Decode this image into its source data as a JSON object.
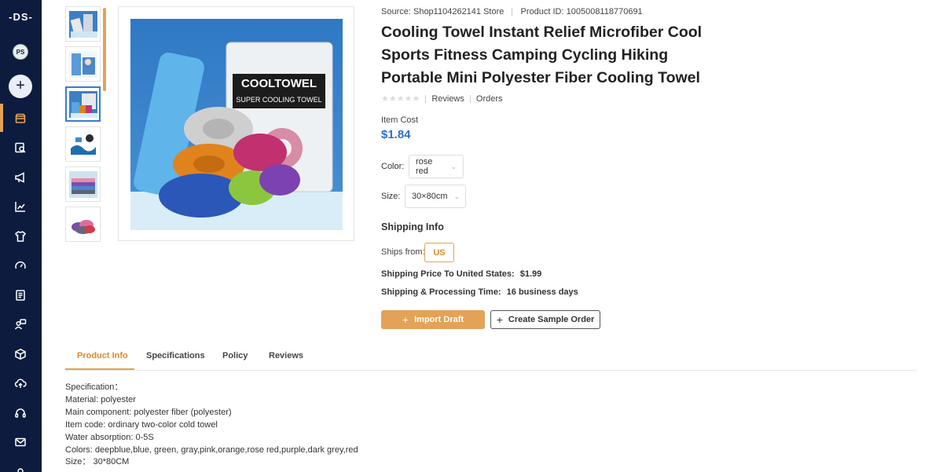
{
  "sidebar": {
    "logo": "-DS-",
    "avatar_initials": "PS",
    "add_label": "+",
    "nav_icons": [
      "store-icon",
      "product-search-icon",
      "megaphone-icon",
      "analytics-icon",
      "apparel-icon",
      "dashboard-gauge-icon",
      "orders-list-icon",
      "support-agent-icon",
      "package-icon",
      "cloud-upload-icon",
      "headset-icon",
      "mail-icon"
    ]
  },
  "product": {
    "source_prefix": "Source:",
    "source_store": "Shop1104262141 Store",
    "product_id_prefix": "Product ID:",
    "product_id": "1005008118770691",
    "title": "Cooling Towel Instant Relief Microfiber Cool Sports Fitness Camping Cycling Hiking Portable Mini Polyester Fiber Cooling Towel",
    "stars": "★★★★★",
    "reviews_label": "Reviews",
    "orders_label": "Orders",
    "item_cost_label": "Item Cost",
    "item_cost": "$1.84",
    "color_label": "Color:",
    "color_value": "rose red",
    "size_label": "Size:",
    "size_value": "30×80cm",
    "image_brand_text": "COOLTOWEL",
    "image_sub_text": "SUPER COOLING TOWEL"
  },
  "shipping": {
    "heading": "Shipping Info",
    "ships_from_label": "Ships from:",
    "ships_from_value": "US",
    "price_label": "Shipping Price To United States:",
    "price_value": "$1.99",
    "time_label": "Shipping & Processing Time:",
    "time_value": "16 business days"
  },
  "actions": {
    "import_label": "Import Draft",
    "sample_label": "Create Sample Order"
  },
  "tabs": [
    {
      "label": "Product Info"
    },
    {
      "label": "Specifications"
    },
    {
      "label": "Policy"
    },
    {
      "label": "Reviews"
    }
  ],
  "description": [
    "Specification：",
    "Material: polyester",
    "Main component: polyester fiber (polyester)",
    "Item code: ordinary two-color cold towel",
    "Water absorption: 0-5S",
    "Colors: deepblue,blue, green, gray,pink,orange,rose red,purple,dark grey,red",
    "Size：  30*80CM"
  ],
  "colors": {
    "sidebar_bg": "#0d1b3e",
    "accent": "#e3a256",
    "price_blue": "#2f6bd8",
    "selected_thumb": "#3a7bd5"
  }
}
